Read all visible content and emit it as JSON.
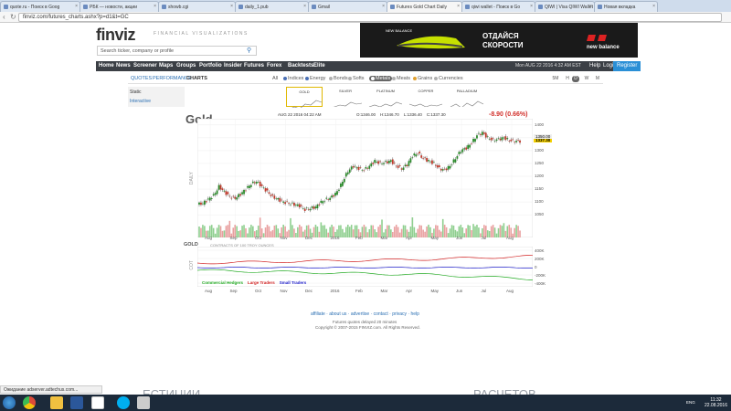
{
  "browser": {
    "tabs": [
      {
        "label": "quote.ru - Поиск в Goog",
        "active": false
      },
      {
        "label": "РБК — новости, акции",
        "active": false
      },
      {
        "label": "showb.cgi",
        "active": false
      },
      {
        "label": "daily_1.pub",
        "active": false
      },
      {
        "label": "Gmail",
        "active": false
      },
      {
        "label": "Futures Gold Chart Daily",
        "active": true
      },
      {
        "label": "qiwi wallet - Поиск в Go",
        "active": false
      },
      {
        "label": "QIWI | Visa QIWI Wallet",
        "active": false
      },
      {
        "label": "Новая вкладка",
        "active": false
      }
    ],
    "url": "finviz.com/futures_charts.ashx?p=d1&t=GC"
  },
  "header": {
    "logo": "finviz",
    "tagline": "FINANCIAL VISUALIZATIONS",
    "search_placeholder": "Search ticker, company or profile",
    "ad": {
      "brand": "new balance",
      "text1": "ОТДАЙСЯ",
      "text2": "СКОРОСТИ",
      "product": "NEW BALANCE"
    }
  },
  "nav": {
    "items": [
      "Home",
      "News",
      "Screener",
      "Maps",
      "Groups",
      "Portfolio",
      "Insider",
      "Futures",
      "Forex",
      "Backtests",
      "Elite"
    ],
    "datetime": "Mon AUG 22 2016 4:32 AM EST",
    "help": "Help",
    "login": "Login",
    "register": "Register"
  },
  "subnav": {
    "tabs": [
      "QUOTES",
      "PERFORMANCE",
      "CHARTS"
    ],
    "active_tab": "CHARTS",
    "categories": [
      {
        "label": "All",
        "color": ""
      },
      {
        "label": "Indices",
        "color": "#4a6fb5"
      },
      {
        "label": "Energy",
        "color": "#4a6fb5"
      },
      {
        "label": "Bonds",
        "color": "#b0b0b0"
      },
      {
        "label": "Softs",
        "color": "#b0b0b0"
      },
      {
        "label": "Metals",
        "color": "#ffffff"
      },
      {
        "label": "Meats",
        "color": "#b0b0b0"
      },
      {
        "label": "Grains",
        "color": "#e0a030"
      },
      {
        "label": "Currencies",
        "color": "#b0b0b0"
      }
    ],
    "active_category": "Metals",
    "timeframes": [
      "5M",
      "H",
      "D",
      "W",
      "M"
    ],
    "active_timeframe": "D",
    "left_panel": [
      "Static",
      "Interactive"
    ],
    "minicharts": [
      "GOLD",
      "SILVER",
      "PLATINUM",
      "COPPER",
      "PALLADIUM"
    ]
  },
  "chart": {
    "title": "Gold",
    "date": "AUG 22 2016 04:22 AM",
    "open": "O:1346.00",
    "high": "H:1346.70",
    "low": "L:1336.40",
    "close": "C:1337.30",
    "change": "-8.90 (0.66%)",
    "side_label": "DAILY",
    "cot_title": "GOLD",
    "cot_sub": "CONTRACTS OF 100 TROY OUNCES",
    "cot_side": "COT",
    "current_price": "1337.30",
    "prev_price": "1350.00"
  },
  "chart_data": {
    "type": "line",
    "title": "Gold",
    "y_ticks": [
      1400,
      1350,
      1300,
      1250,
      1200,
      1150,
      1100,
      1050
    ],
    "x_ticks": [
      "Aug",
      "Sep",
      "Oct",
      "Nov",
      "Dec",
      "2016",
      "Feb",
      "Mar",
      "Apr",
      "May",
      "Jun",
      "Jul",
      "Aug"
    ],
    "ylim": [
      1040,
      1410
    ],
    "close_series": [
      1090,
      1095,
      1110,
      1125,
      1160,
      1140,
      1120,
      1115,
      1130,
      1150,
      1170,
      1180,
      1160,
      1140,
      1120,
      1110,
      1100,
      1095,
      1090,
      1085,
      1070,
      1075,
      1080,
      1100,
      1110,
      1120,
      1140,
      1180,
      1220,
      1240,
      1230,
      1225,
      1240,
      1260,
      1250,
      1255,
      1260,
      1240,
      1230,
      1245,
      1280,
      1290,
      1270,
      1260,
      1250,
      1230,
      1225,
      1240,
      1270,
      1300,
      1310,
      1330,
      1360,
      1370,
      1350,
      1340,
      1345,
      1350,
      1340,
      1337
    ],
    "cot": {
      "y_ticks": [
        "400K",
        "200K",
        "0",
        "-200K",
        "-400K"
      ],
      "series": [
        {
          "name": "Commercial Hedgers",
          "color": "#22aa22"
        },
        {
          "name": "Large Traders",
          "color": "#d22222"
        },
        {
          "name": "Small Traders",
          "color": "#2222cc"
        }
      ]
    }
  },
  "footer": {
    "links": [
      "affiliate",
      "about us",
      "advertise",
      "contact",
      "privacy",
      "help"
    ],
    "delay": "Futures quotes delayed 20 minutes",
    "copyright": "Copyright © 2007-2015 FINVIZ.com. All Rights Reserved."
  },
  "status": "Ожидание adserver.adtechus.com...",
  "background_text": [
    "ЕСТИЦИИ",
    "РАСЧЕТОВ"
  ],
  "taskbar": {
    "lang": "ENG",
    "time": "11:32",
    "date": "22.08.2016"
  }
}
